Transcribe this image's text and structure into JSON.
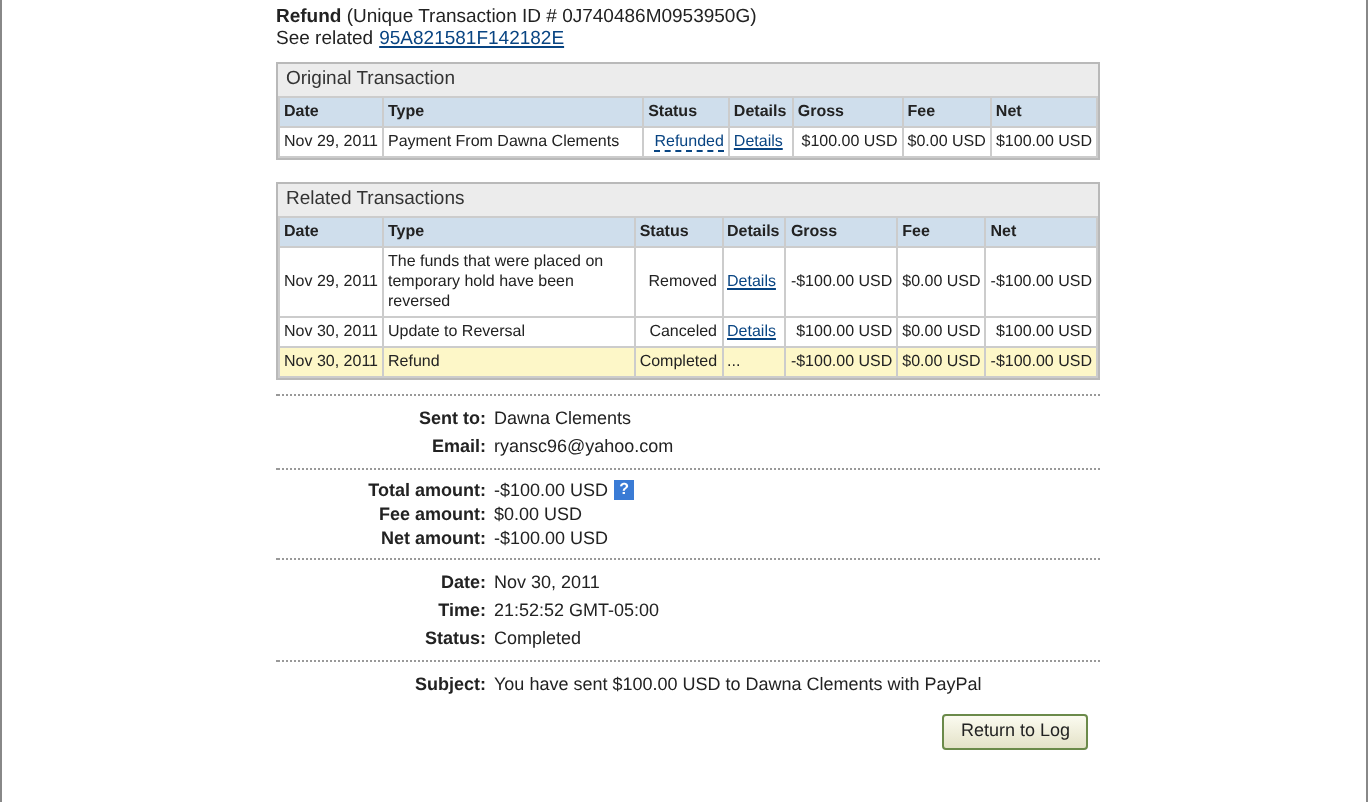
{
  "heading": {
    "title": "Refund",
    "id_text": "(Unique Transaction ID # 0J740486M0953950G)",
    "related_label": "See related",
    "related_link": "95A821581F142182E"
  },
  "tables": [
    {
      "title": "Original Transaction",
      "columns": [
        "Date",
        "Type",
        "Status",
        "Details",
        "Gross",
        "Fee",
        "Net"
      ],
      "rows": [
        {
          "selected": false,
          "date": "Nov 29, 2011",
          "type": "Payment From Dawna Clements",
          "status": {
            "text": "Refunded",
            "kind": "link"
          },
          "details": {
            "text": "Details",
            "kind": "link"
          },
          "gross": "$100.00 USD",
          "fee": "$0.00 USD",
          "net": "$100.00 USD"
        }
      ]
    },
    {
      "title": "Related Transactions",
      "columns": [
        "Date",
        "Type",
        "Status",
        "Details",
        "Gross",
        "Fee",
        "Net"
      ],
      "rows": [
        {
          "selected": false,
          "date": "Nov 29, 2011",
          "type": "The funds that were placed on temporary hold have been reversed",
          "status": {
            "text": "Removed",
            "kind": "text"
          },
          "details": {
            "text": "Details",
            "kind": "link"
          },
          "gross": "-$100.00 USD",
          "fee": "$0.00 USD",
          "net": "-$100.00 USD"
        },
        {
          "selected": false,
          "date": "Nov 30, 2011",
          "type": "Update to Reversal",
          "status": {
            "text": "Canceled",
            "kind": "text"
          },
          "details": {
            "text": "Details",
            "kind": "link"
          },
          "gross": "$100.00 USD",
          "fee": "$0.00 USD",
          "net": "$100.00 USD"
        },
        {
          "selected": true,
          "date": "Nov 30, 2011",
          "type": "Refund",
          "status": {
            "text": "Completed",
            "kind": "text"
          },
          "details": {
            "text": "...",
            "kind": "text"
          },
          "gross": "-$100.00 USD",
          "fee": "$0.00 USD",
          "net": "-$100.00 USD"
        }
      ]
    }
  ],
  "sections": [
    [
      {
        "label": "Sent to:",
        "value": "Dawna Clements"
      },
      {
        "label": "Email:",
        "value": "ryansc96@yahoo.com"
      }
    ],
    [
      {
        "label": "Total amount:",
        "value": "-$100.00 USD",
        "help": "?"
      },
      {
        "label": "Fee amount:",
        "value": "$0.00 USD"
      },
      {
        "label": "Net amount:",
        "value": "-$100.00 USD"
      }
    ],
    [
      {
        "label": "Date:",
        "value": "Nov 30, 2011"
      },
      {
        "label": "Time:",
        "value": "21:52:52 GMT-05:00"
      },
      {
        "label": "Status:",
        "value": "Completed"
      }
    ],
    [
      {
        "label": "Subject:",
        "value": "You have sent $100.00 USD to Dawna Clements with PayPal"
      }
    ]
  ],
  "button": "Return to Log"
}
